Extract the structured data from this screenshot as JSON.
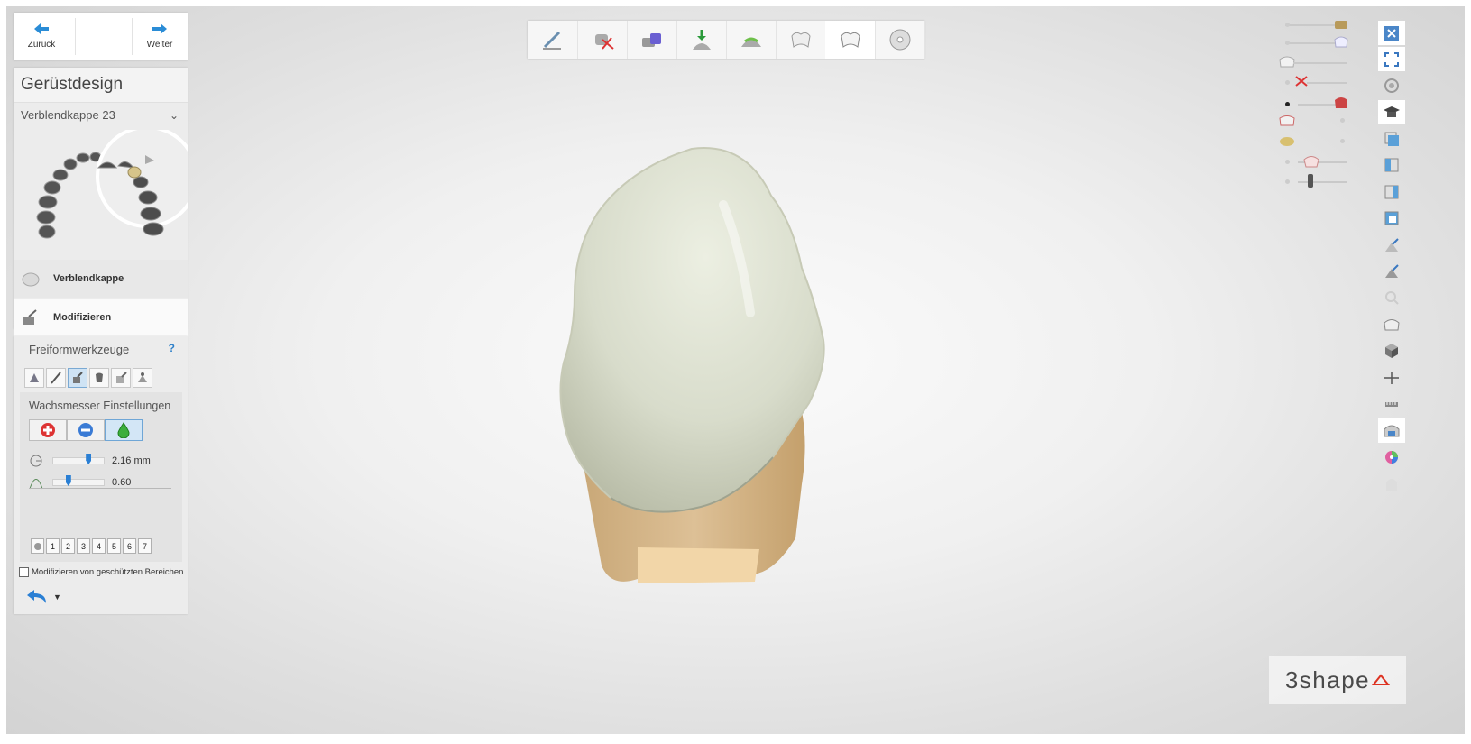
{
  "nav": {
    "back_label": "Zurück",
    "next_label": "Weiter"
  },
  "design": {
    "title": "Gerüstdesign",
    "tooth_select": "Verblendkappe 23",
    "steps": [
      {
        "label": "Verblendkappe",
        "icon": "crown-icon"
      },
      {
        "label": "Modifizieren",
        "icon": "modify-icon"
      }
    ]
  },
  "freeform": {
    "title": "Freiformwerkzeuge",
    "help": "?",
    "tools": [
      "add-remove-tool-icon",
      "wax-knife-tool-icon",
      "smooth-tool-icon",
      "morph-tool-icon",
      "shrink-tool-icon",
      "anatomy-tool-icon"
    ],
    "wax": {
      "title": "Wachsmesser Einstellungen",
      "modes": [
        "add-mode-icon",
        "remove-mode-icon",
        "smooth-mode-icon"
      ],
      "radius_value": "2.16 mm",
      "radius_fraction": 0.7,
      "strength_value": "0.60",
      "strength_fraction": 0.3
    },
    "presets": [
      "1",
      "2",
      "3",
      "4",
      "5",
      "6",
      "7"
    ],
    "protect_label": "Modifizieren von geschützten Bereichen"
  },
  "workflow_steps": [
    "prep-icon",
    "trim-icon",
    "die-icon",
    "insertion-icon",
    "margin-icon",
    "coping-icon",
    "veneer-icon",
    "disk-icon"
  ],
  "right_tools": [
    "close-view-icon",
    "fit-screen-icon",
    "rotate-icon",
    "learn-icon",
    "view-front-icon",
    "view-left-icon",
    "view-right-icon",
    "view-back-icon",
    "clip-plane-icon",
    "section-icon",
    "zoom-icon",
    "crown-icon",
    "cube-icon",
    "measure-icon",
    "ruler-icon",
    "occlusion-icon",
    "color-map-icon",
    "transparency-icon"
  ],
  "colors": {
    "accent": "#2a7fd4",
    "crown": "#d7dbc8",
    "die": "#d8b77f"
  },
  "logo": "3shape"
}
